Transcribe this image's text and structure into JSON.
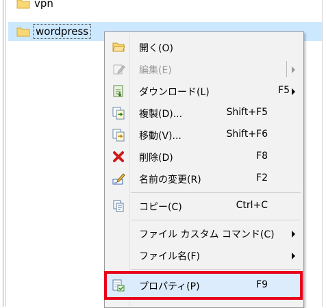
{
  "files": [
    {
      "name": "vpn",
      "selected": false
    },
    {
      "name": "wordpress",
      "selected": true
    }
  ],
  "context_menu": {
    "items": [
      {
        "label": "開く(O)",
        "shortcut": "",
        "icon": "open-folder-icon",
        "disabled": false,
        "submenu": false
      },
      {
        "label": "編集(E)",
        "shortcut": "",
        "icon": "edit-pencil-icon",
        "disabled": true,
        "submenu": true
      },
      {
        "label": "ダウンロード(L)",
        "shortcut": "F5",
        "icon": "download-icon",
        "disabled": false,
        "submenu": true
      },
      {
        "label": "複製(D)...",
        "shortcut": "Shift+F5",
        "icon": "duplicate-icon",
        "disabled": false,
        "submenu": false
      },
      {
        "label": "移動(V)...",
        "shortcut": "Shift+F6",
        "icon": "move-icon",
        "disabled": false,
        "submenu": false
      },
      {
        "label": "削除(D)",
        "shortcut": "F8",
        "icon": "delete-x-icon",
        "disabled": false,
        "submenu": false
      },
      {
        "label": "名前の変更(R)",
        "shortcut": "F2",
        "icon": "rename-icon",
        "disabled": false,
        "submenu": false
      },
      {
        "label": "コピー(C)",
        "shortcut": "Ctrl+C",
        "icon": "copy-icon",
        "disabled": false,
        "submenu": false
      },
      {
        "label": "ファイル カスタム コマンド(C)",
        "shortcut": "",
        "icon": "",
        "disabled": false,
        "submenu": true
      },
      {
        "label": "ファイル名(F)",
        "shortcut": "",
        "icon": "",
        "disabled": false,
        "submenu": true
      },
      {
        "label": "プロパティ(P)",
        "shortcut": "F9",
        "icon": "properties-icon",
        "disabled": false,
        "submenu": false,
        "highlighted": true
      }
    ]
  },
  "colors": {
    "selection": "#cce8ff",
    "highlight_border": "#e8001c",
    "menu_bg": "#f2f2f2",
    "folder": "#f8d775"
  }
}
